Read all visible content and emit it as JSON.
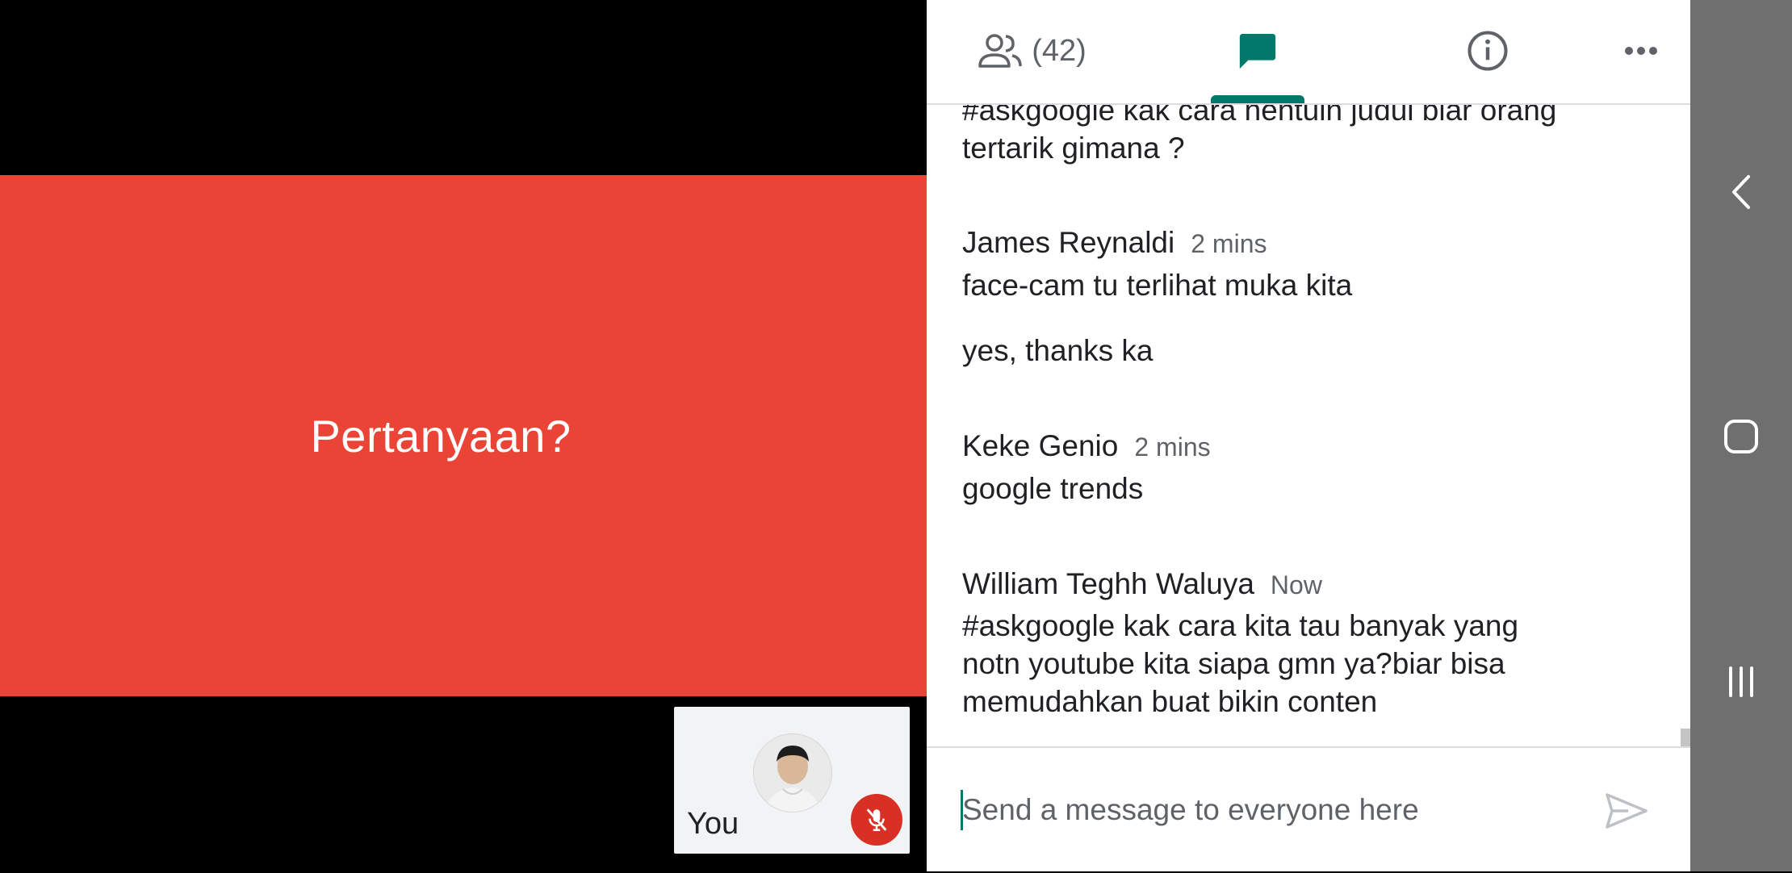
{
  "stage": {
    "slide_title": "Pertanyaan?",
    "self_label": "You",
    "mic_state": "muted"
  },
  "tabs": {
    "people_count": "(42)",
    "active": "chat"
  },
  "messages": [
    {
      "sender": "",
      "time": "",
      "lines": [
        "#askgoogle kak cara nentuin judul biar orang",
        "tertarik gimana ?"
      ]
    },
    {
      "sender": "James Reynaldi",
      "time": "2 mins",
      "lines": [
        "face-cam tu terlihat muka kita"
      ]
    },
    {
      "sender": "",
      "time": "",
      "lines": [
        "yes, thanks ka"
      ]
    },
    {
      "sender": "Keke Genio",
      "time": "2 mins",
      "lines": [
        "google trends"
      ]
    },
    {
      "sender": "William Teghh Waluya",
      "time": "Now",
      "lines": [
        "#askgoogle kak cara kita tau banyak yang",
        "notn youtube kita siapa gmn ya?biar bisa",
        "memudahkan buat bikin conten"
      ]
    }
  ],
  "composer": {
    "placeholder": "Send a message to everyone here"
  },
  "colors": {
    "slide_bg": "#e94435",
    "accent": "#00796b",
    "mic_muted": "#d93025"
  }
}
